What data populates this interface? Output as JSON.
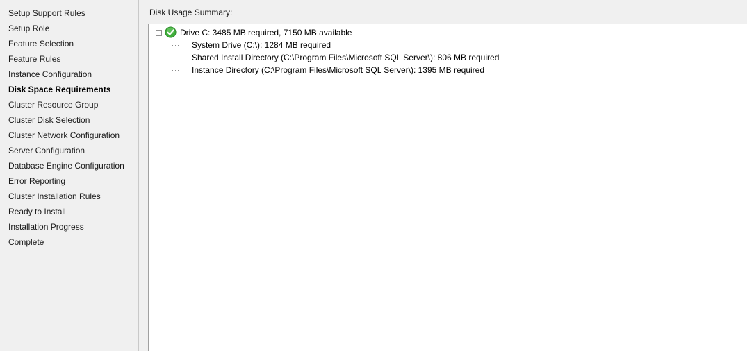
{
  "sidebar": {
    "items": [
      {
        "label": "Setup Support Rules"
      },
      {
        "label": "Setup Role"
      },
      {
        "label": "Feature Selection"
      },
      {
        "label": "Feature Rules"
      },
      {
        "label": "Instance Configuration"
      },
      {
        "label": "Disk Space Requirements",
        "active": true
      },
      {
        "label": "Cluster Resource Group"
      },
      {
        "label": "Cluster Disk Selection"
      },
      {
        "label": "Cluster Network Configuration"
      },
      {
        "label": "Server Configuration"
      },
      {
        "label": "Database Engine Configuration"
      },
      {
        "label": "Error Reporting"
      },
      {
        "label": "Cluster Installation Rules"
      },
      {
        "label": "Ready to Install"
      },
      {
        "label": "Installation Progress"
      },
      {
        "label": "Complete"
      }
    ]
  },
  "main": {
    "summary_label": "Disk Usage Summary:",
    "tree": {
      "root": {
        "label": "Drive C: 3485 MB required, 7150 MB available",
        "icon": "green-check-icon",
        "expanded": true
      },
      "children": [
        {
          "label": "System Drive (C:\\): 1284 MB required"
        },
        {
          "label": "Shared Install Directory (C:\\Program Files\\Microsoft SQL Server\\): 806 MB required"
        },
        {
          "label": "Instance Directory (C:\\Program Files\\Microsoft SQL Server\\): 1395 MB required"
        }
      ]
    }
  },
  "colors": {
    "check_green": "#3fae3a",
    "panel_bg": "#f0f0f0",
    "tree_bg": "#ffffff"
  }
}
